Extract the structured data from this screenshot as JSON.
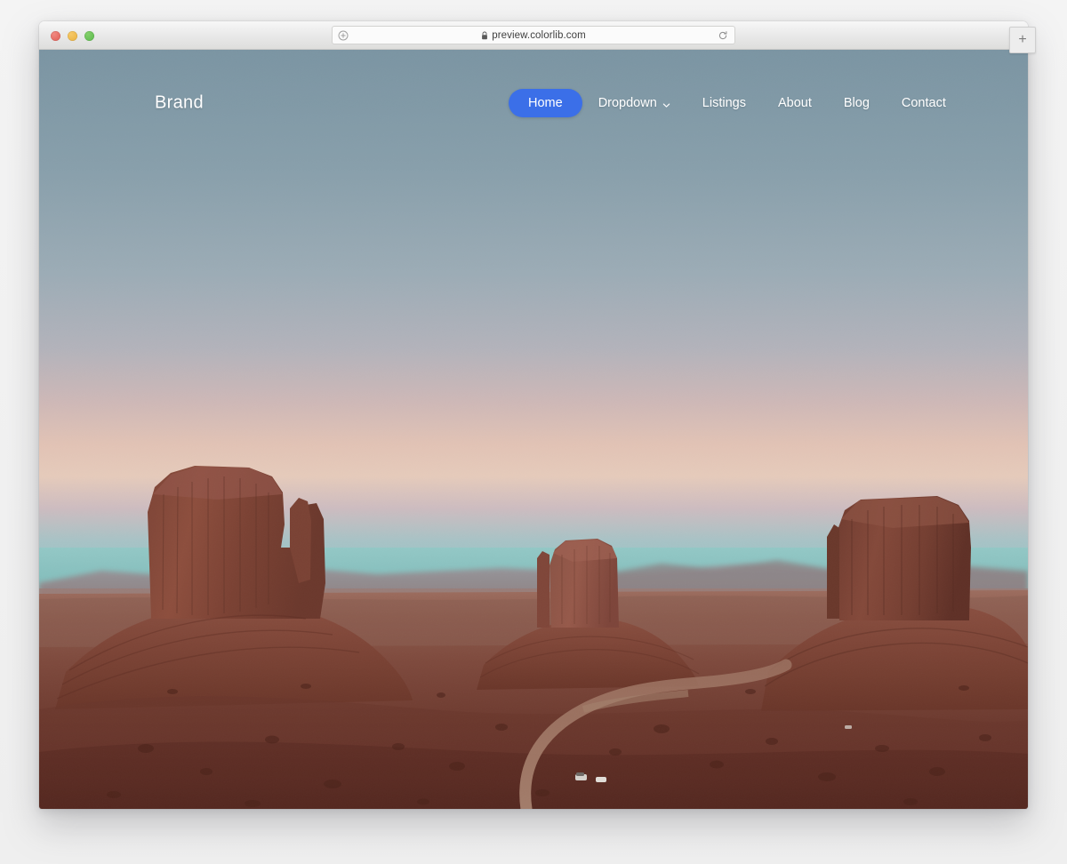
{
  "browser": {
    "traffic_lights": [
      {
        "name": "close",
        "color": "#e05b52"
      },
      {
        "name": "minimize",
        "color": "#e9b03c"
      },
      {
        "name": "maximize",
        "color": "#58b94b"
      }
    ],
    "url": "preview.colorlib.com",
    "url_secure": true,
    "left_icon": "add-site-icon",
    "reload_icon": "reload-icon",
    "new_tab_label": "+"
  },
  "site": {
    "brand": "Brand",
    "accent_color": "#3b6fe8",
    "nav": [
      {
        "label": "Home",
        "active": true,
        "has_dropdown": false
      },
      {
        "label": "Dropdown",
        "active": false,
        "has_dropdown": true
      },
      {
        "label": "Listings",
        "active": false,
        "has_dropdown": false
      },
      {
        "label": "About",
        "active": false,
        "has_dropdown": false
      },
      {
        "label": "Blog",
        "active": false,
        "has_dropdown": false
      },
      {
        "label": "Contact",
        "active": false,
        "has_dropdown": false
      }
    ],
    "hero": {
      "scene": "monument-valley-buttes-at-dusk",
      "sky_top_color": "#7d97a4",
      "sky_mid_color": "#b6b4bb",
      "sky_glow_color": "#e0c3b4",
      "horizon_color": "#8fc5c4",
      "desert_near_color": "#5a2b22",
      "desert_far_color": "#9a6355"
    }
  }
}
